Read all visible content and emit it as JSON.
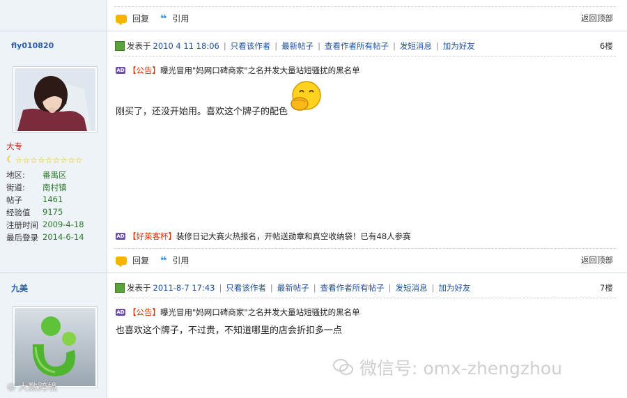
{
  "top_actions": {
    "reply": "回复",
    "quote": "引用",
    "back_top": "返回顶部"
  },
  "posts": [
    {
      "author": "fly010820",
      "posted_prefix": "发表于",
      "date": "2010 4 11 18:06",
      "links": [
        "只看该作者",
        "最新帖子",
        "查看作者所有帖子",
        "发短消息",
        "加为好友"
      ],
      "floor": "6楼",
      "notice": {
        "tag": "【公告】",
        "text": "曝光冒用\"妈网口碑商家\"之名并发大量站短骚扰的黑名单"
      },
      "body": "刚买了，还没开始用。喜欢这个牌子的配色",
      "emoji": "covering-mouth-laugh",
      "rank": "大专",
      "stars": 9,
      "stats": [
        {
          "label": "地区:",
          "value": "番禺区"
        },
        {
          "label": "街道:",
          "value": "南村镇"
        },
        {
          "label": "帖子",
          "value": "1461"
        },
        {
          "label": "经验值",
          "value": "9175"
        },
        {
          "label": "注册时间",
          "value": "2009-4-18"
        },
        {
          "label": "最后登录",
          "value": "2014-6-14"
        }
      ],
      "ad": {
        "tag": "【好莱客杯】",
        "text": "装修日记大赛火热报名，开帖送勋章和真空收纳袋！已有48人参赛"
      },
      "actions": {
        "reply": "回复",
        "quote": "引用",
        "back_top": "返回顶部"
      }
    },
    {
      "author": "九美",
      "posted_prefix": "发表于",
      "date": "2011-8-7 17:43",
      "links": [
        "只看该作者",
        "最新帖子",
        "查看作者所有帖子",
        "发短消息",
        "加为好友"
      ],
      "floor": "7楼",
      "notice": {
        "tag": "【公告】",
        "text": "曝光冒用\"妈网口碑商家\"之名并发大量站短骚扰的黑名单"
      },
      "body": "也喜欢这个牌子，不过贵，不知道哪里的店会折扣多一点"
    }
  ],
  "watermark": {
    "text": "微信号: omx-zhengzhou",
    "left_text": "大数跨境"
  },
  "colors": {
    "link": "#1e4f9a",
    "sidebar_bg": "#eef3f8",
    "stat_value": "#2a7a2a"
  }
}
